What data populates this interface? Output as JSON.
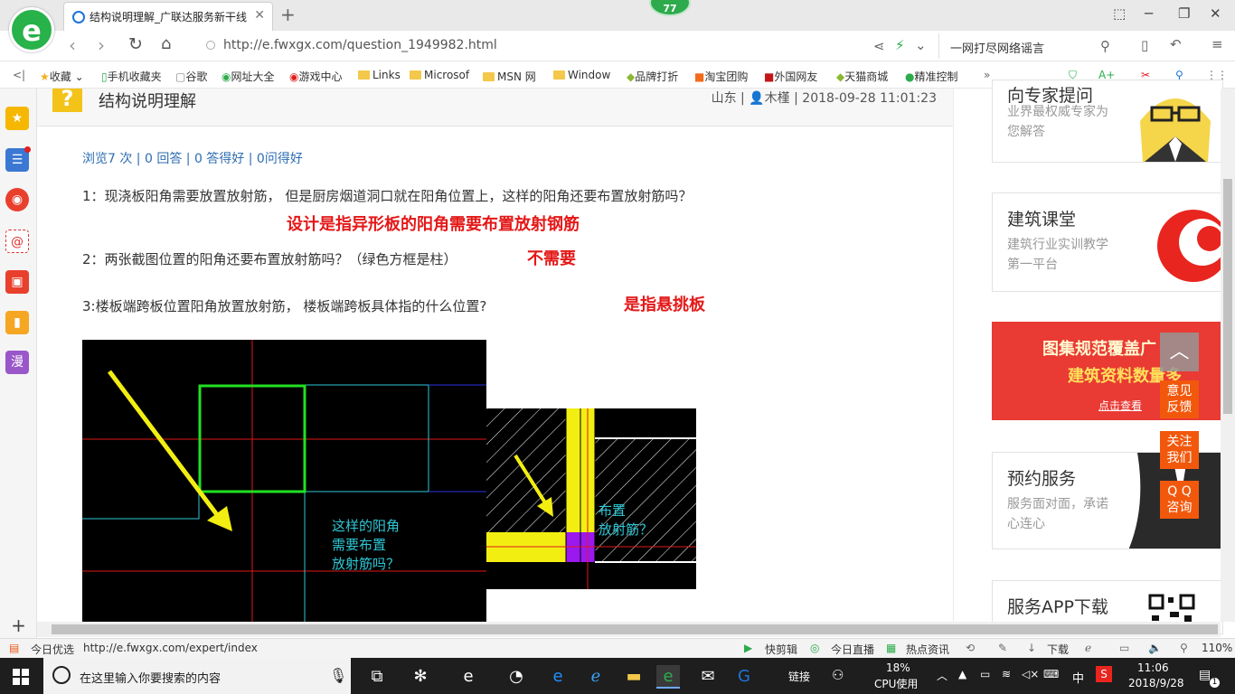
{
  "tab": {
    "title": "结构说明理解_广联达服务新干线"
  },
  "badge_count": "77",
  "address": {
    "url": "http://e.fwxgx.com/question_1949982.html",
    "search_text": "一网打尽网络谣言"
  },
  "bookmarks": [
    "收藏",
    "手机收藏夹",
    "谷歌",
    "网址大全",
    "游戏中心",
    "Links",
    "Microsof",
    "MSN 网",
    "Window",
    "品牌打折",
    "淘宝团购",
    "外国网友",
    "天猫商城",
    "精准控制"
  ],
  "question": {
    "title": "结构说明理解",
    "location": "山东",
    "author": "木槿",
    "datetime": "2018-09-28 11:01:23",
    "stats": "浏览7 次 | 0 回答 | 0 答得好 | 0问得好",
    "q1": "1：现浇板阳角需要放置放射筋， 但是厨房烟道洞口就在阳角位置上，这样的阳角还要布置放射筋吗？",
    "a1": "设计是指异形板的阳角需要布置放射钢筋",
    "q2": "2：两张截图位置的阳角还要布置放射筋吗？（绿色方框是柱）",
    "a2": "不需要",
    "q3": "3:楼板端跨板位置阳角放置放射筋， 楼板端跨板具体指的什么位置?",
    "a3": "是指悬挑板",
    "img1_label": [
      "这样的阳角",
      "需要布置",
      "放射筋吗？"
    ],
    "img2_label": [
      "布置",
      "放射筋？"
    ]
  },
  "right": {
    "card_expert": {
      "title": "向专家提问",
      "desc": "业界最权威专家为您解答"
    },
    "card_class": {
      "title": "建筑课堂",
      "desc": "建筑行业实训教学第一平台"
    },
    "promo": {
      "line1": "图集规范覆盖广",
      "line2": "建筑资料数量多",
      "cta": "点击查看"
    },
    "card_service": {
      "title": "预约服务",
      "desc": "服务面对面，承诺心连心"
    },
    "card_app": {
      "title": "服务APP下载"
    },
    "float": {
      "feedback": "意见反馈",
      "follow": "关注我们",
      "qq": "Q Q咨询"
    }
  },
  "status": {
    "left": "今日优选",
    "url": "http://e.fwxgx.com/expert/index",
    "items": [
      "快剪辑",
      "今日直播",
      "热点资讯",
      "下载"
    ],
    "zoom": "110%"
  },
  "taskbar": {
    "search_placeholder": "在这里输入你要搜索的内容",
    "link_label": "链接",
    "cpu_pct": "18%",
    "cpu_label": "CPU使用",
    "ime": "中",
    "time": "11:06",
    "date": "2018/9/28",
    "notif": "1"
  }
}
